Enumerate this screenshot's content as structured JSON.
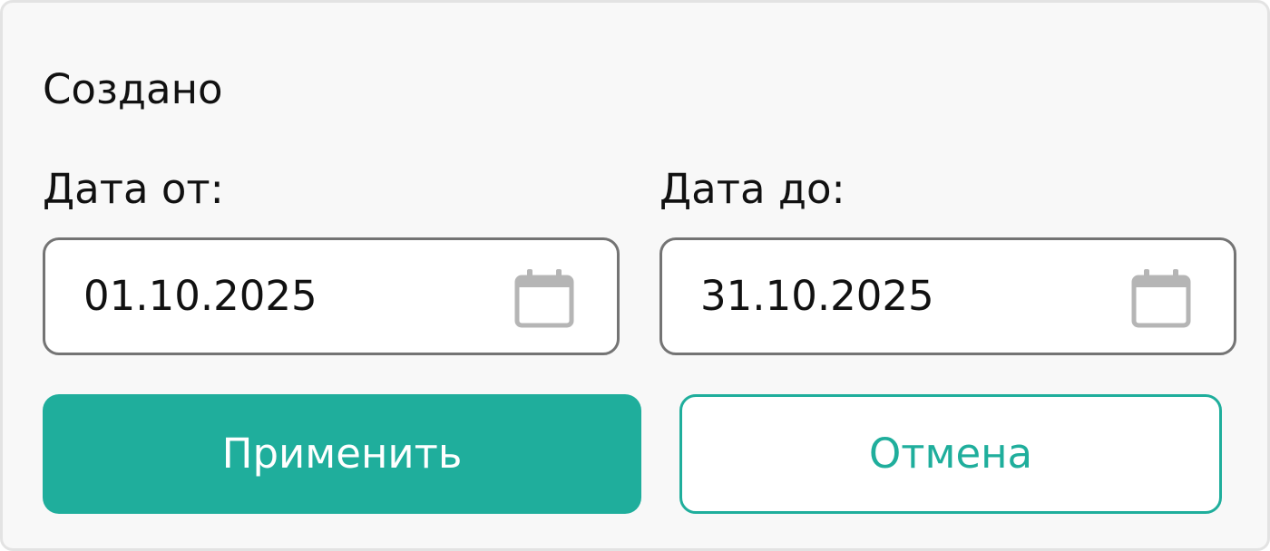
{
  "filter": {
    "title": "Создано",
    "date_from": {
      "label": "Дата от:",
      "value": "01.10.2025",
      "icon": "calendar-icon"
    },
    "date_to": {
      "label": "Дата до:",
      "value": "31.10.2025",
      "icon": "calendar-icon"
    },
    "apply_label": "Применить",
    "cancel_label": "Отмена"
  },
  "colors": {
    "accent": "#1fae9c",
    "field_border": "#747474",
    "icon": "#b5b5b5",
    "panel_bg": "#f8f8f8"
  }
}
